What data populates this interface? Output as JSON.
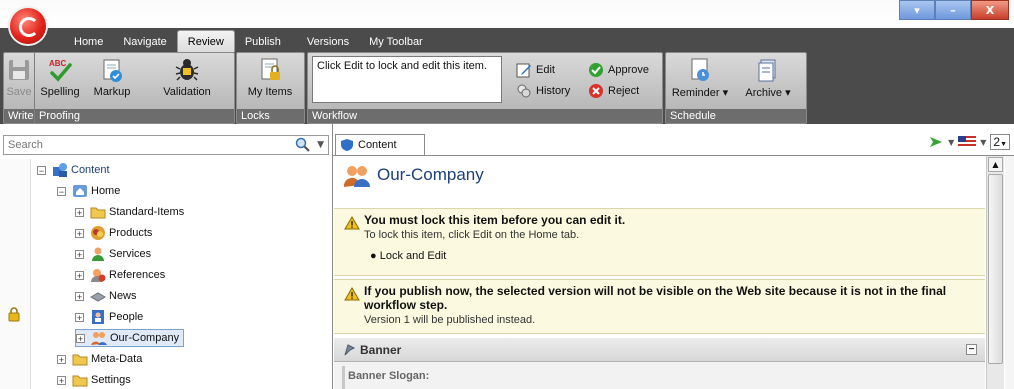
{
  "tabs": [
    "Home",
    "Navigate",
    "Review",
    "Publish",
    "Versions",
    "My Toolbar"
  ],
  "active_tab": "Review",
  "ribbon": {
    "write": {
      "label": "Write",
      "save": "Save"
    },
    "proofing": {
      "label": "Proofing",
      "spelling": "Spelling",
      "markup": "Markup",
      "validation": "Validation"
    },
    "locks": {
      "label": "Locks",
      "my_items": "My Items"
    },
    "workflow": {
      "label": "Workflow",
      "info": "Click Edit to lock and edit this item.",
      "edit": "Edit",
      "history": "History",
      "approve": "Approve",
      "reject": "Reject"
    },
    "schedule": {
      "label": "Schedule",
      "reminder": "Reminder",
      "archive": "Archive"
    }
  },
  "search": {
    "placeholder": "Search"
  },
  "tree": {
    "content": "Content",
    "home": "Home",
    "standard_items": "Standard-Items",
    "products": "Products",
    "services": "Services",
    "references": "References",
    "news": "News",
    "people": "People",
    "our_company": "Our-Company",
    "meta_data": "Meta-Data",
    "settings": "Settings",
    "expand_glyph": "+",
    "collapse_glyph": "−"
  },
  "editor": {
    "tab_label": "Content",
    "version_selector": "2",
    "item_title": "Our-Company",
    "warning1": {
      "title": "You must lock this item before you can edit it.",
      "desc": "To lock this item, click Edit on the Home tab.",
      "action": "Lock and Edit"
    },
    "warning2": {
      "title": "If you publish now, the selected version will not be visible on the Web site because it is not in the final workflow step.",
      "desc": "Version 1 will be published instead."
    },
    "section": "Banner",
    "field_label": "Banner Slogan:"
  },
  "colors": {
    "ribbon_dark": "#4b4b4b",
    "warning_bg": "#fbfae0",
    "title_blue": "#1d3f7a"
  }
}
